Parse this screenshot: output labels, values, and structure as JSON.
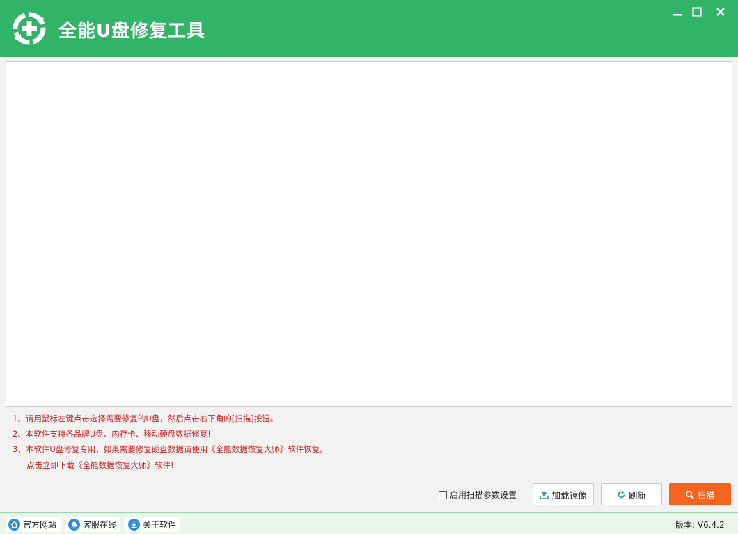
{
  "app": {
    "title": "全能U盘修复工具",
    "accent_color": "#31b467",
    "scan_color": "#f5641f",
    "tip_color": "#d02020"
  },
  "window_controls": {
    "minimize_icon": "minimize-icon",
    "maximize_icon": "maximize-icon",
    "close_icon": "close-icon"
  },
  "tips": {
    "line1": "1、请用鼠标左键点击选择需要修复的U盘，然后点击右下角的[扫描]按钮。",
    "line2": "2、本软件支持各品牌U盘、内存卡、移动硬盘数据修复!",
    "line3": "3、本软件U盘修复专用，如果需要修复硬盘数据请使用《全能数据恢复大师》软件恢复。",
    "download_link": "点击立即下载《全能数据恢复大师》软件!"
  },
  "options": {
    "scan_settings_label": "启用扫描参数设置",
    "scan_settings_checked": false
  },
  "buttons": {
    "load_image": "加载镜像",
    "refresh": "刷新",
    "scan": "扫描"
  },
  "statusbar": {
    "official_site": "官方网站",
    "customer_service": "客服在线",
    "about": "关于软件",
    "version": "版本: V6.4.2"
  }
}
